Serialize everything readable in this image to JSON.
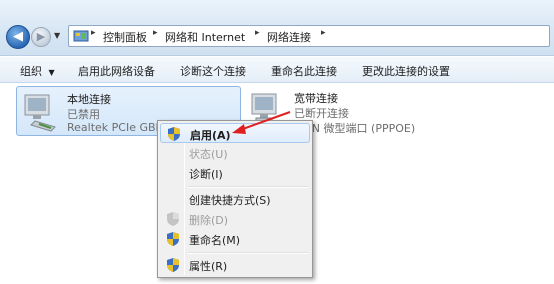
{
  "address": {
    "crumbs": [
      "控制面板",
      "网络和 Internet",
      "网络连接"
    ]
  },
  "toolbar": {
    "organize": "组织",
    "enable_device": "启用此网络设备",
    "diagnose": "诊断这个连接",
    "rename": "重命名此连接",
    "change_settings": "更改此连接的设置"
  },
  "connections": {
    "local": {
      "name": "本地连接",
      "status": "已禁用",
      "device": "Realtek PCIe GBE"
    },
    "broadband": {
      "name": "宽带连接",
      "status": "已断开连接",
      "device": "WAN 微型端口 (PPPOE)"
    }
  },
  "menu": {
    "enable": "启用(A)",
    "status": "状态(U)",
    "diagnose": "诊断(I)",
    "shortcut": "创建快捷方式(S)",
    "delete": "删除(D)",
    "rename": "重命名(M)",
    "properties": "属性(R)"
  },
  "colors": {
    "annotation_arrow": "#e02020",
    "highlight": "#dfecfb"
  }
}
